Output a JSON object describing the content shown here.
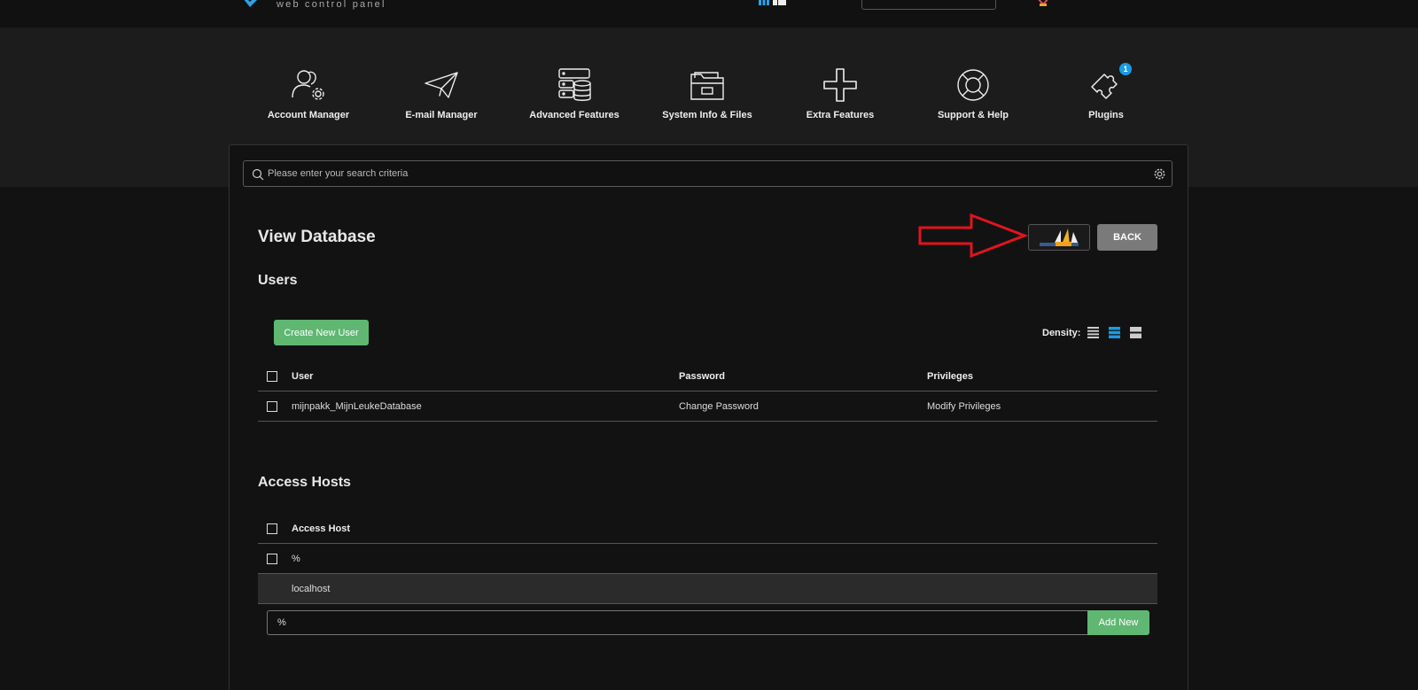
{
  "header": {
    "logo_subtitle": "web control panel",
    "logo_icon": "brand-check-icon",
    "view_icons": "grid-icons",
    "user_icon": "user-flag-icon"
  },
  "nav": {
    "items": [
      {
        "label": "Account Manager",
        "icon": "account-manager-icon"
      },
      {
        "label": "E-mail Manager",
        "icon": "paper-plane-icon"
      },
      {
        "label": "Advanced Features",
        "icon": "server-database-icon"
      },
      {
        "label": "System Info & Files",
        "icon": "folder-icon"
      },
      {
        "label": "Extra Features",
        "icon": "plus-icon"
      },
      {
        "label": "Support & Help",
        "icon": "lifebuoy-icon"
      },
      {
        "label": "Plugins",
        "icon": "puzzle-icon",
        "badge": "1"
      }
    ]
  },
  "search": {
    "placeholder": "Please enter your search criteria",
    "value": ""
  },
  "page": {
    "title": "View Database",
    "back_label": "BACK",
    "phpmyadmin_logo": "phpmyadmin-logo-icon",
    "annotation": "red-arrow-icon"
  },
  "users": {
    "title": "Users",
    "create_label": "Create New User",
    "density_label": "Density:",
    "density_active": "medium",
    "columns": {
      "user": "User",
      "password": "Password",
      "privileges": "Privileges"
    },
    "rows": [
      {
        "user": "mijnpakk_MijnLeukeDatabase",
        "password": "Change Password",
        "privileges": "Modify Privileges"
      }
    ]
  },
  "hosts": {
    "title": "Access Hosts",
    "column": "Access Host",
    "rows": [
      {
        "host": "%",
        "checkbox": true,
        "shaded": false
      },
      {
        "host": "localhost",
        "checkbox": false,
        "shaded": true
      }
    ],
    "new_value": "%",
    "add_label": "Add New"
  },
  "colors": {
    "accent_green": "#5fb772",
    "accent_blue": "#1a9be6",
    "annotation_red": "#e0141e",
    "back_gray": "#7a7a7a"
  }
}
